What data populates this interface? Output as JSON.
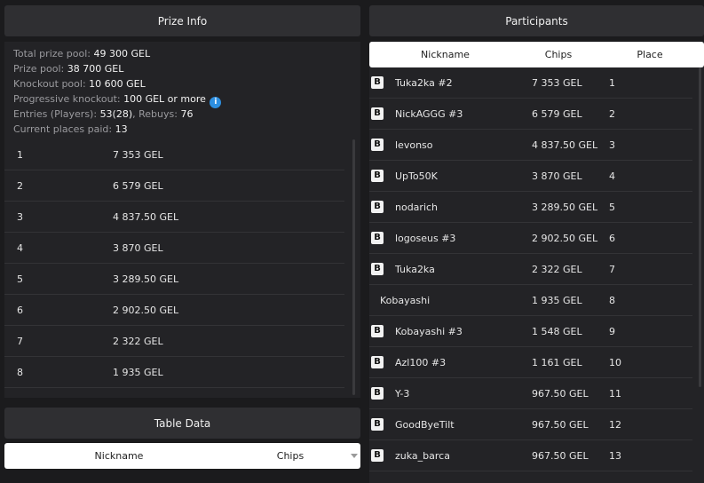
{
  "prize_info": {
    "title": "Prize Info",
    "lines": [
      {
        "label": "Total prize pool: ",
        "value": "49 300 GEL"
      },
      {
        "label": "Prize pool: ",
        "value": "38 700 GEL"
      },
      {
        "label": "Knockout pool: ",
        "value": "10 600 GEL"
      },
      {
        "label": "Progressive knockout: ",
        "value": "100 GEL or more",
        "icon": "info-icon"
      },
      {
        "label": "Entries (Players): ",
        "value": "53(28)",
        "label2": ", Rebuys: ",
        "value2": "76"
      },
      {
        "label": "Current places paid: ",
        "value": "13"
      }
    ],
    "places": [
      {
        "place": "1",
        "amount": "7 353 GEL"
      },
      {
        "place": "2",
        "amount": "6 579 GEL"
      },
      {
        "place": "3",
        "amount": "4 837.50 GEL"
      },
      {
        "place": "4",
        "amount": "3 870 GEL"
      },
      {
        "place": "5",
        "amount": "3 289.50 GEL"
      },
      {
        "place": "6",
        "amount": "2 902.50 GEL"
      },
      {
        "place": "7",
        "amount": "2 322 GEL"
      },
      {
        "place": "8",
        "amount": "1 935 GEL"
      }
    ]
  },
  "participants": {
    "title": "Participants",
    "columns": {
      "nickname": "Nickname",
      "chips": "Chips",
      "place": "Place"
    },
    "badge_letter": "B",
    "rows": [
      {
        "nick": "Tuka2ka #2",
        "chips": "7 353 GEL",
        "place": "1",
        "badge": true
      },
      {
        "nick": "NickAGGG #3",
        "chips": "6 579 GEL",
        "place": "2",
        "badge": true
      },
      {
        "nick": "levonso",
        "chips": "4 837.50 GEL",
        "place": "3",
        "badge": true
      },
      {
        "nick": "UpTo50K",
        "chips": "3 870 GEL",
        "place": "4",
        "badge": true
      },
      {
        "nick": "nodarich",
        "chips": "3 289.50 GEL",
        "place": "5",
        "badge": true
      },
      {
        "nick": "logoseus #3",
        "chips": "2 902.50 GEL",
        "place": "6",
        "badge": true
      },
      {
        "nick": "Tuka2ka",
        "chips": "2 322 GEL",
        "place": "7",
        "badge": true
      },
      {
        "nick": "Kobayashi",
        "chips": "1 935 GEL",
        "place": "8",
        "badge": false
      },
      {
        "nick": "Kobayashi #3",
        "chips": "1 548 GEL",
        "place": "9",
        "badge": true
      },
      {
        "nick": "Azl100 #3",
        "chips": "1 161 GEL",
        "place": "10",
        "badge": true
      },
      {
        "nick": "Y-3",
        "chips": "967.50 GEL",
        "place": "11",
        "badge": true
      },
      {
        "nick": "GoodByeTilt",
        "chips": "967.50 GEL",
        "place": "12",
        "badge": true
      },
      {
        "nick": "zuka_barca",
        "chips": "967.50 GEL",
        "place": "13",
        "badge": true
      }
    ]
  },
  "table_data": {
    "title": "Table Data",
    "columns": {
      "nickname": "Nickname",
      "chips": "Chips"
    }
  }
}
